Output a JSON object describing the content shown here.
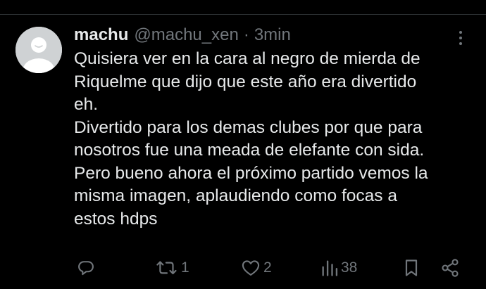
{
  "tweet": {
    "display_name": "machu",
    "handle": "@machu_xen",
    "separator": "·",
    "timestamp": "3min",
    "text_lines": [
      "Quisiera ver en la cara al negro de mierda de",
      "Riquelme que dijo que este año era divertido",
      "eh.",
      "Divertido para los demas clubes por que para",
      "nosotros fue una meada de elefante con sida.",
      "Pero bueno ahora el próximo partido vemos la",
      "misma imagen, aplaudiendo como focas a",
      "estos hdps"
    ]
  },
  "actions": {
    "reply": {
      "icon": "reply-icon",
      "count": ""
    },
    "retweet": {
      "icon": "retweet-icon",
      "count": "1"
    },
    "like": {
      "icon": "heart-icon",
      "count": "2"
    },
    "views": {
      "icon": "views-icon",
      "count": "38"
    },
    "bookmark": {
      "icon": "bookmark-icon"
    },
    "share": {
      "icon": "share-icon"
    }
  },
  "colors": {
    "background": "#000000",
    "text_primary": "#e7e9ea",
    "text_secondary": "#71767b",
    "divider": "#2f3336",
    "avatar_bg": "#cfd2d4"
  }
}
